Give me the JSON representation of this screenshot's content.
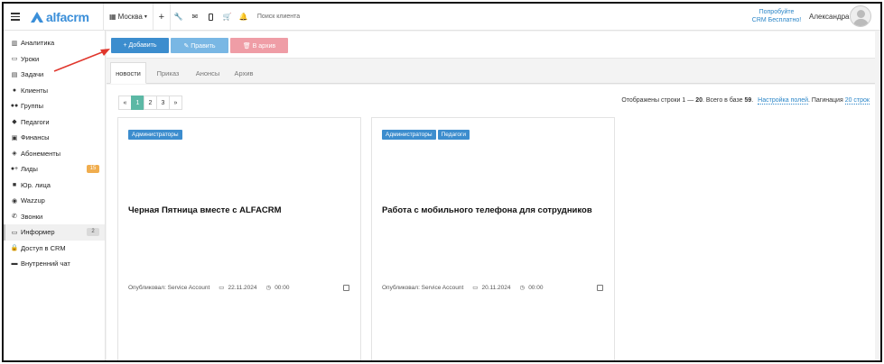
{
  "topbar": {
    "logo_text": "alfacrm",
    "branch": "Москва",
    "plus_icon": "+",
    "search_placeholder": "Поиск клиента",
    "promo_line1": "Попробуйте",
    "promo_line2": "CRM Бесплатно!",
    "user_name": "Александра"
  },
  "sidebar": {
    "items": [
      {
        "icon": "analytics-icon",
        "label": "Аналитика"
      },
      {
        "icon": "calendar-icon",
        "label": "Уроки"
      },
      {
        "icon": "tasks-icon",
        "label": "Задачи"
      },
      {
        "icon": "user-icon",
        "label": "Клиенты"
      },
      {
        "icon": "group-icon",
        "label": "Группы"
      },
      {
        "icon": "teacher-icon",
        "label": "Педагоги"
      },
      {
        "icon": "money-icon",
        "label": "Финансы"
      },
      {
        "icon": "tag-icon",
        "label": "Абонементы"
      },
      {
        "icon": "add-user-icon",
        "label": "Лиды",
        "badge": "15"
      },
      {
        "icon": "briefcase-icon",
        "label": "Юр. лица"
      },
      {
        "icon": "whatsapp-icon",
        "label": "Wazzup"
      },
      {
        "icon": "phone-icon",
        "label": "Звонки"
      },
      {
        "icon": "window-icon",
        "label": "Информер",
        "badge": "2"
      },
      {
        "icon": "lock-icon",
        "label": "Доступ в CRM"
      },
      {
        "icon": "chat-icon",
        "label": "Внутренний чат"
      }
    ]
  },
  "actions": {
    "add_label": "+ Добавить",
    "edit_label": "✎ Править",
    "archive_label": "🗑 В архив"
  },
  "tabs": [
    {
      "label": "новости",
      "active": true
    },
    {
      "label": "Приказ"
    },
    {
      "label": "Анонсы"
    },
    {
      "label": "Архив"
    }
  ],
  "pager": {
    "prev": "«",
    "pages": [
      "1",
      "2",
      "3"
    ],
    "next": "»",
    "current": "1"
  },
  "status": {
    "prefix": "Отображены строки 1 — ",
    "to": "20",
    "middle": ". Всего в базе ",
    "total": "59",
    "suffix": ".",
    "settings_link": "Настройка полей",
    "pagination_label": ". Пагинация",
    "pagination_link": "20 строк"
  },
  "cards": [
    {
      "tags": [
        "Администраторы"
      ],
      "title": "Черная Пятница вместе с ALFACRM",
      "published": "Опубликовал: Service Account",
      "date": "22.11.2024",
      "time": "00:00"
    },
    {
      "tags": [
        "Администраторы",
        "Педагоги"
      ],
      "title": "Работа с мобильного телефона для сотрудников",
      "published": "Опубликовал: Service Account",
      "date": "20.11.2024",
      "time": "00:00"
    }
  ],
  "colors": {
    "accent": "#3c8dce",
    "edit": "#79b7e4",
    "archive": "#ef9da6",
    "pager_active": "#5cb8a5",
    "badge_orange": "#f0ad4e",
    "annotation_arrow": "#e0362c"
  }
}
